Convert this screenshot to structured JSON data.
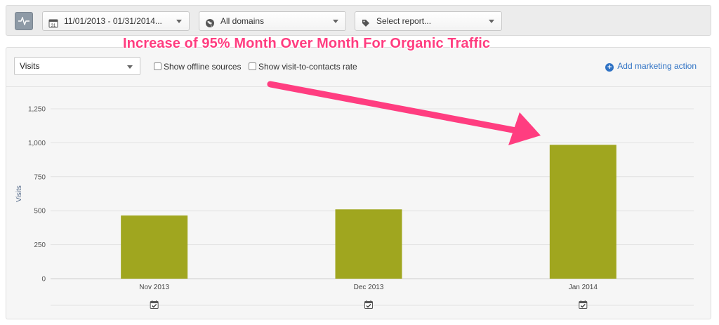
{
  "toolbar": {
    "date_range": "11/01/2013 - 01/31/2014...",
    "domains": "All domains",
    "report": "Select report..."
  },
  "controls": {
    "metric_select": "Visits",
    "show_offline_sources": "Show offline sources",
    "show_visit_to_contacts": "Show visit-to-contacts rate",
    "add_marketing_action": "Add marketing action"
  },
  "annotation": {
    "text": "Increase of 95% Month Over Month For Organic Traffic",
    "color": "#ff3d80"
  },
  "icons": {
    "pulse": "pulse-icon",
    "calendar": "calendar-icon",
    "globe": "globe-icon",
    "tag": "tag-icon",
    "plus": "plus-circle-icon",
    "event": "calendar-check-icon"
  },
  "chart_data": {
    "type": "bar",
    "title": "",
    "xlabel": "",
    "ylabel": "Visits",
    "categories": [
      "Nov 2013",
      "Dec 2013",
      "Jan 2014"
    ],
    "values": [
      465,
      510,
      985
    ],
    "ylim": [
      0,
      1250
    ],
    "yticks": [
      0,
      250,
      500,
      750,
      1000,
      1250
    ],
    "ytick_labels": [
      "0",
      "250",
      "500",
      "750",
      "1,000",
      "1,250"
    ],
    "bar_color": "#a0a61f",
    "grid": true
  }
}
